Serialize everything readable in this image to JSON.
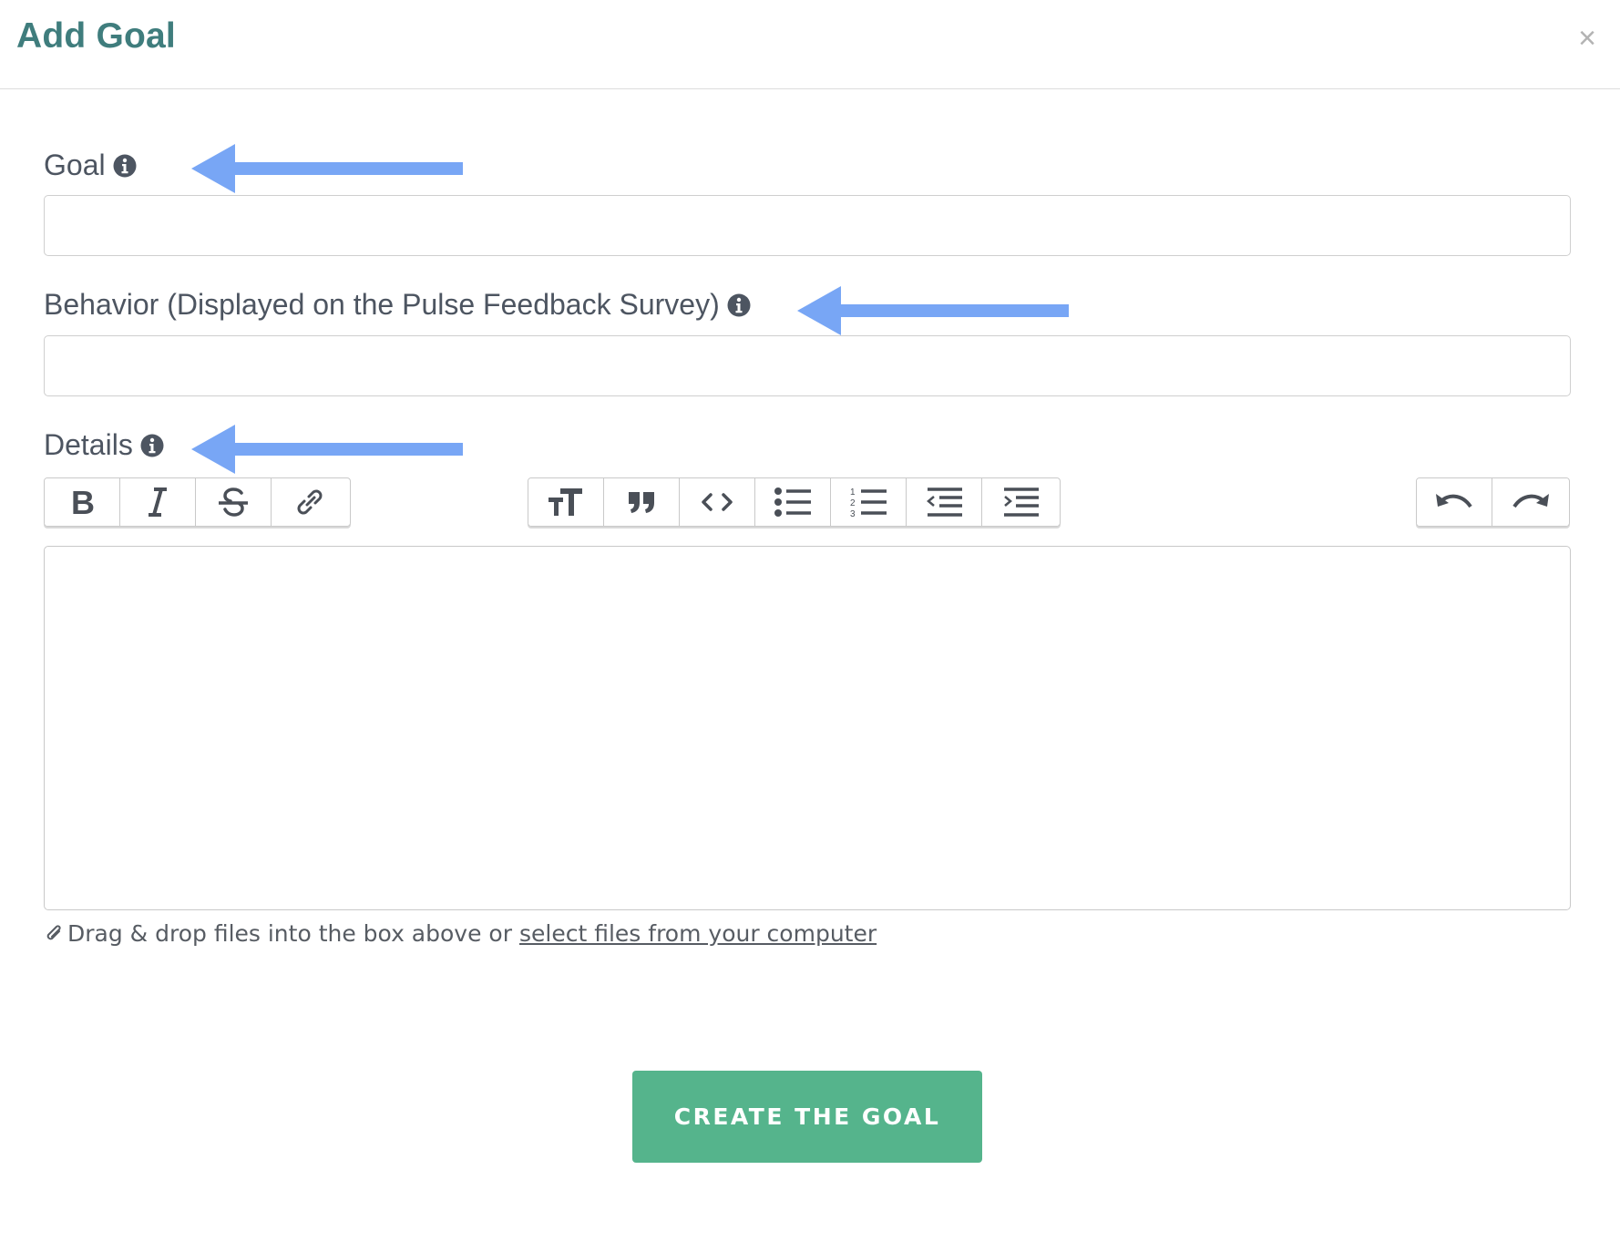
{
  "modal": {
    "title": "Add Goal",
    "close_label": "×"
  },
  "fields": {
    "goal": {
      "label": "Goal",
      "value": "",
      "placeholder": ""
    },
    "behavior": {
      "label": "Behavior (Displayed on the Pulse Feedback Survey)",
      "value": "",
      "placeholder": ""
    },
    "details": {
      "label": "Details"
    }
  },
  "toolbar": {
    "groups": [
      {
        "name": "text-formatting",
        "items": [
          "bold-icon",
          "italic-icon",
          "strikethrough-icon",
          "link-icon"
        ]
      },
      {
        "name": "block-formatting",
        "items": [
          "heading-icon",
          "quote-icon",
          "code-icon",
          "bullet-list-icon",
          "numbered-list-icon",
          "outdent-icon",
          "indent-icon"
        ]
      },
      {
        "name": "history",
        "items": [
          "undo-icon",
          "redo-icon"
        ]
      }
    ]
  },
  "attachment": {
    "text": "Drag & drop files into the box above or",
    "link_text": "select files from your computer"
  },
  "submit": {
    "label": "CREATE THE GOAL"
  },
  "colors": {
    "title": "#3f7d7d",
    "button": "#55b48c",
    "annotation_arrow": "#78a6f5"
  }
}
